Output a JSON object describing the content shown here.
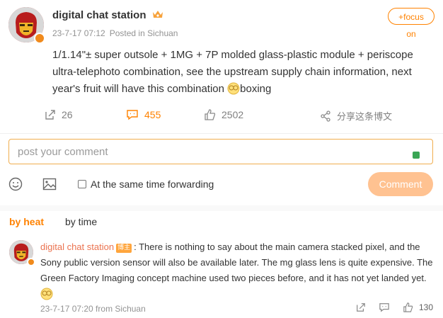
{
  "post": {
    "username": "digital chat station",
    "timestamp": "23-7-17 07:12",
    "location": "Posted in Sichuan",
    "follow_label": "+focus on",
    "text": "1/1.14\"± super outsole + 1MG + 7P molded glass-plastic module + periscope ultra-telephoto combination, see the upstream supply chain information, next year's fruit will have this combination ",
    "text_tail": "boxing",
    "emoji_name": "boxing-emoji"
  },
  "actions": {
    "forward_count": "26",
    "comment_count": "455",
    "like_count": "2502",
    "share_label": "分享这条博文"
  },
  "composer": {
    "placeholder": "post your comment",
    "forward_label": "At the same time forwarding",
    "submit_label": "Comment"
  },
  "sort": {
    "heat_label": "by heat",
    "time_label": "by time"
  },
  "comment": {
    "username": "digital chat station",
    "badge": "博主",
    "text": ": There is nothing to say about the main camera stacked pixel, and the Sony public version sensor will also be available later. The mg glass lens is quite expensive. The Green Factory Imaging concept machine used two pieces before, and it has not yet landed yet.",
    "meta": "23-7-17 07:20 from Sichuan",
    "like_count": "130"
  },
  "colors": {
    "accent": "#ff8200",
    "comment_user": "#eb7350",
    "submit_disabled": "#ffc291"
  }
}
